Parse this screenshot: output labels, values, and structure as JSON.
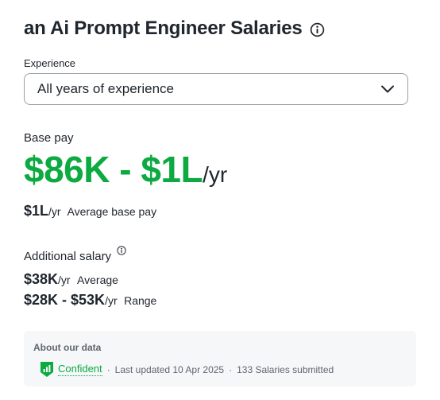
{
  "header": {
    "title": "an Ai Prompt Engineer Salaries",
    "info_icon": "info-circle-icon"
  },
  "experience": {
    "label": "Experience",
    "selected": "All years of experience",
    "chevron_icon": "chevron-down-icon"
  },
  "base_pay": {
    "label": "Base pay",
    "range": "$86K - $1L",
    "range_unit": "/yr",
    "average_value": "$1L",
    "average_unit": "/yr",
    "average_label": "Average base pay"
  },
  "additional_salary": {
    "label": "Additional salary",
    "info_icon": "info-circle-icon",
    "average_value": "$38K",
    "average_unit": "/yr",
    "average_label": "Average",
    "range_value": "$28K - $53K",
    "range_unit": "/yr",
    "range_label": "Range"
  },
  "about_data": {
    "title": "About our data",
    "confidence_icon": "confidence-shield-icon",
    "confidence": "Confident",
    "separator": "·",
    "last_updated": "Last updated 10 Apr 2025",
    "submissions": "133 Salaries submitted"
  },
  "colors": {
    "accent_green": "#0caa41",
    "text": "#20262e",
    "muted": "#5f6670",
    "panel_bg": "#f6f7f9"
  }
}
